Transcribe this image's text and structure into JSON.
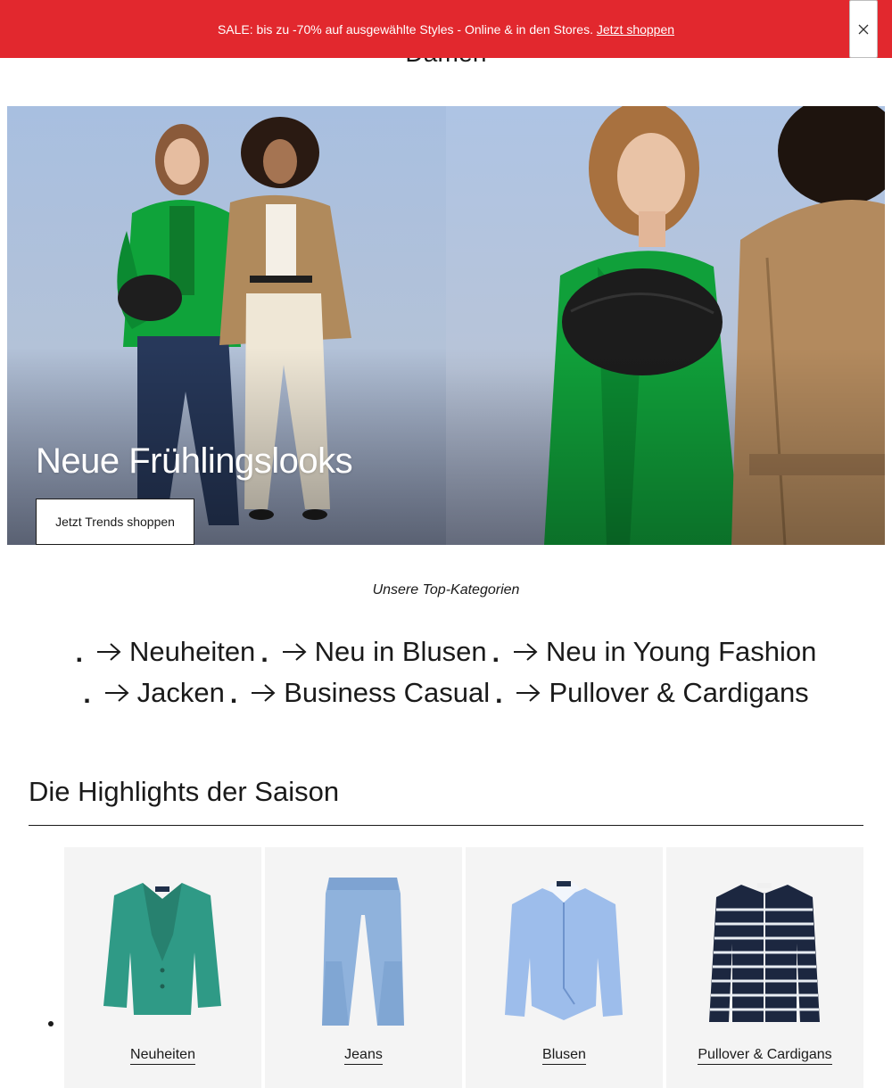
{
  "promo": {
    "text": "SALE: bis zu -70% auf ausgewählte Styles - Online & in den Stores.",
    "link_label": "Jetzt shoppen",
    "close_icon": "close-icon",
    "background": "#e2282e"
  },
  "page": {
    "heading": "Damen"
  },
  "hero": {
    "title": "Neue Frühlingslooks",
    "cta_label": "Jetzt Trends shoppen"
  },
  "top_categories": {
    "label": "Unsere Top-Kategorien",
    "row1": [
      {
        "label": "Neuheiten",
        "icon": "arrow-right-icon"
      },
      {
        "label": "Neu in Blusen",
        "icon": "arrow-right-icon"
      },
      {
        "label": "Neu in Young Fashion",
        "icon": "arrow-right-icon"
      }
    ],
    "row2": [
      {
        "label": "Jacken",
        "icon": "arrow-right-icon"
      },
      {
        "label": "Business Casual",
        "icon": "arrow-right-icon"
      },
      {
        "label": "Pullover & Cardigans",
        "icon": "arrow-right-icon"
      }
    ]
  },
  "highlights": {
    "title": "Die Highlights der Saison",
    "cards": [
      {
        "label": "Neuheiten"
      },
      {
        "label": "Jeans"
      },
      {
        "label": "Blusen"
      },
      {
        "label": "Pullover & Cardigans"
      }
    ]
  }
}
